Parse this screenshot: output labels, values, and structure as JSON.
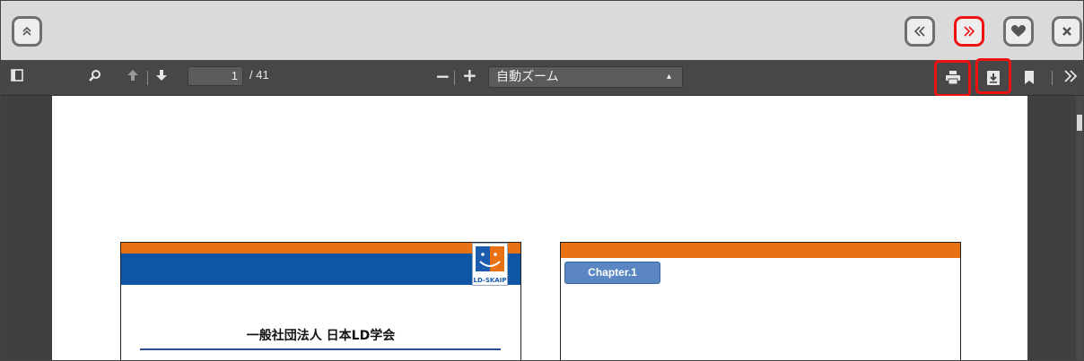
{
  "topbar": {
    "buttons": [
      {
        "name": "collapse-up-button",
        "icon": "double-chevron-up-icon"
      },
      {
        "name": "previous-button",
        "icon": "double-chevron-left-icon"
      },
      {
        "name": "next-button",
        "icon": "double-chevron-right-icon",
        "highlighted": true
      },
      {
        "name": "favorite-button",
        "icon": "heart-icon"
      },
      {
        "name": "close-button",
        "icon": "close-icon"
      }
    ]
  },
  "pdf_toolbar": {
    "current_page": "1",
    "page_count": "/ 41",
    "zoom_minus": "−",
    "zoom_plus": "+",
    "zoom_value": "自動ズーム",
    "highlighted_buttons": [
      "print-button",
      "download-button"
    ]
  },
  "document": {
    "slide1": {
      "logo_text": "LD-SKAIP",
      "title": "一般社団法人 日本LD学会"
    },
    "slide2": {
      "chapter_label": "Chapter.1"
    }
  },
  "colors": {
    "highlight": "#ee1111",
    "orange": "#e87213",
    "blue": "#0f55a6",
    "toolbar": "#474747"
  }
}
